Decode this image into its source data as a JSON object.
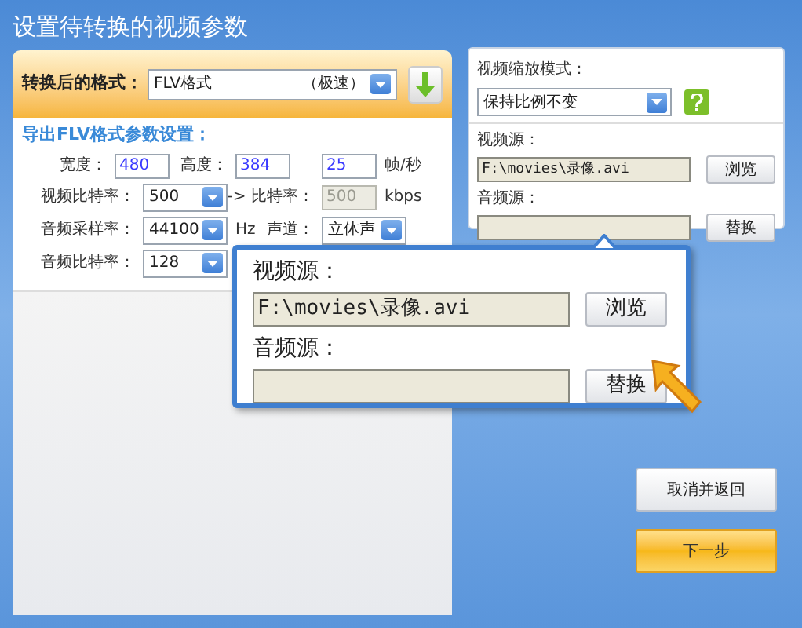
{
  "title": "设置待转换的视频参数",
  "format": {
    "label": "转换后的格式：",
    "value": "FLV格式",
    "speed": "（极速）"
  },
  "section_title": "导出FLV格式参数设置：",
  "rows": [
    [
      {
        "kind": "label",
        "text": "宽度："
      },
      {
        "kind": "input",
        "value": "480",
        "disabled": false
      },
      {
        "kind": "label",
        "text": "高度："
      },
      {
        "kind": "input",
        "value": "384",
        "disabled": false
      },
      {
        "kind": "gap"
      },
      {
        "kind": "input",
        "value": "25",
        "disabled": false
      },
      {
        "kind": "unit",
        "text": "帧/秒"
      }
    ],
    [
      {
        "kind": "label",
        "text": "视频比特率："
      },
      {
        "kind": "select",
        "value": "500"
      },
      {
        "kind": "label",
        "text": "-> 比特率："
      },
      {
        "kind": "input",
        "value": "500",
        "disabled": true
      },
      {
        "kind": "unit",
        "text": "kbps"
      }
    ],
    [
      {
        "kind": "label",
        "text": "音频采样率："
      },
      {
        "kind": "select",
        "value": "44100"
      },
      {
        "kind": "unit",
        "text": "Hz"
      },
      {
        "kind": "label",
        "text": "声道："
      },
      {
        "kind": "select",
        "value": "立体声"
      }
    ],
    [
      {
        "kind": "label",
        "text": "音频比特率："
      },
      {
        "kind": "select",
        "value": "128"
      }
    ]
  ],
  "scale": {
    "label": "视频缩放模式：",
    "value": "保持比例不变"
  },
  "sources": [
    {
      "label": "视频源：",
      "value": "F:\\movies\\录像.avi",
      "button": "浏览"
    },
    {
      "label": "音频源：",
      "button": "替换"
    }
  ],
  "popup": {
    "sources": [
      {
        "label": "视频源：",
        "value": "F:\\movies\\录像.avi",
        "button": "浏览"
      },
      {
        "label": "音频源：",
        "button": "替换"
      }
    ]
  },
  "buttons": [
    {
      "label": "取消并返回",
      "kind": "secondary"
    },
    {
      "label": "下一步",
      "kind": "primary"
    }
  ]
}
